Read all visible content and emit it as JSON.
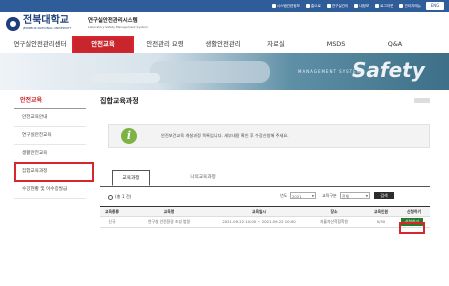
{
  "topbar": {
    "links": [
      "시스템관련정보",
      "홈으로",
      "연구실관리",
      "내정보",
      "로그아웃",
      "관리자메뉴"
    ],
    "lang": "ENG"
  },
  "brand": {
    "university": "전북대학교",
    "university_en": "JEONBUK NATIONAL UNIVERSITY",
    "system": "연구실안전관리시스템",
    "system_en": "Laboratory Safety Management System"
  },
  "gnb": [
    "연구실안전관리센터",
    "안전교육",
    "안전관리 요령",
    "생활안전관리",
    "자료실",
    "MSDS",
    "Q&A"
  ],
  "banner": {
    "sub": "MANAGEMENT SYSTEM",
    "word": "Safety"
  },
  "lnb": {
    "title": "안전교육",
    "items": [
      "안전교육안내",
      "연구실안전교육",
      "생활안전교육",
      "집합교육과정",
      "수강현황 및 이수증발급"
    ]
  },
  "content": {
    "title": "집합교육과정",
    "notice": "안전보건교육 개설과정 목록입니다. 세부내용 확인 후 수강신청해 주세요.",
    "tabs": [
      "교육과정",
      "나의교육과정"
    ],
    "count": "(총 1 건)",
    "year_label": "년도",
    "year_value": "2021",
    "type_label": "교육구분",
    "type_value": "전체",
    "search_label": "검색",
    "headers": [
      "교육종류",
      "교육명",
      "교육일시",
      "장소",
      "교육인원",
      "신청하기"
    ],
    "rows": [
      {
        "type": "신규",
        "name": "연구실 안전환경 조성 법령",
        "date": "2021.09.22 10:00 ~ 2021.09.22 10:00",
        "place": "자율자산적합학원",
        "quota": "0/30",
        "apply": "신청하기"
      }
    ]
  },
  "colors": {
    "topbar": "#2f5d9a",
    "active_menu": "#c8252c",
    "highlight": "#d8262e",
    "apply_button": "#2b7a2b"
  }
}
